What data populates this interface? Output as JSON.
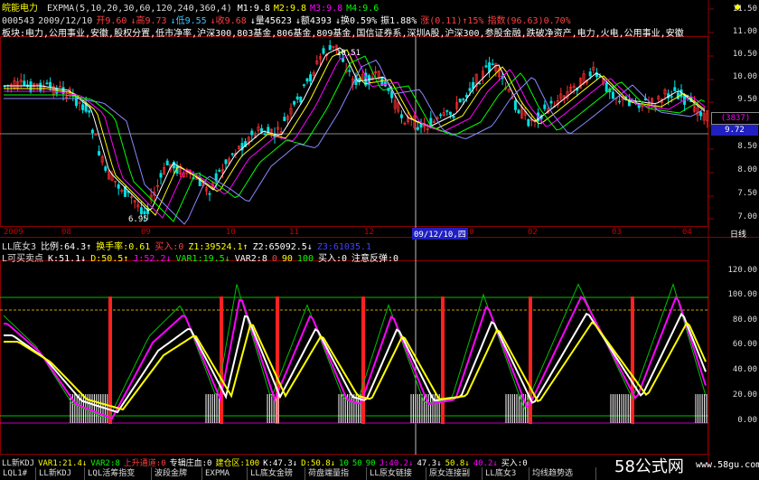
{
  "header": {
    "name": "皖能电力",
    "indicator_line": "EXPMA(5,10,20,30,60,120,240,360,4)",
    "m_values": [
      {
        "label": "M1:9.8",
        "color": "#ffffff"
      },
      {
        "label": "M2:9.8",
        "color": "#ffff00"
      },
      {
        "label": "M3:9.8",
        "color": "#ff00ff"
      },
      {
        "label": "M4:9.6",
        "color": "#00ff00"
      }
    ],
    "quote_line": [
      {
        "text": "000543",
        "color": "#dddddd"
      },
      {
        "text": "2009/12/10",
        "color": "#dddddd"
      },
      {
        "text": "开9.60",
        "color": "#ff4040"
      },
      {
        "text": "↓高9.73",
        "color": "#ff4040"
      },
      {
        "text": "↓低9.55",
        "color": "#40c0ff"
      },
      {
        "text": "↓收9.68",
        "color": "#ff4040"
      },
      {
        "text": "↓量45623",
        "color": "#ffffff"
      },
      {
        "text": "↓额4393",
        "color": "#ffffff"
      },
      {
        "text": "↓换0.59%",
        "color": "#ffffff"
      },
      {
        "text": "振1.88%",
        "color": "#ffffff"
      },
      {
        "text": "涨(0.11)↑15%",
        "color": "#ff4040"
      },
      {
        "text": "指数(96.63)0.70%",
        "color": "#ff4040"
      }
    ],
    "sector_line": "板块:电力,公用事业,安徽,股权分置,低市净率,沪深300,803基金,806基金,809基金,国信证券系,深圳A股,沪深300,参股金融,跌破净资产,电力,火电,公用事业,安徽"
  },
  "price_axis": [
    "11.50",
    "11.00",
    "10.50",
    "10.00",
    "9.50",
    "9.00",
    "8.50",
    "8.00",
    "7.50",
    "7.00"
  ],
  "price_labels": {
    "current_tag": "(3837)",
    "current_price": "9.72",
    "low_mark": "6.95",
    "high_mark": "10.51"
  },
  "time_axis": [
    {
      "label": "2009"
    },
    {
      "label": "08"
    },
    {
      "label": "09"
    },
    {
      "label": "10"
    },
    {
      "label": "11"
    },
    {
      "label": "12"
    },
    {
      "label": "2010"
    },
    {
      "label": "02"
    },
    {
      "label": "03"
    },
    {
      "label": "04"
    }
  ],
  "cursor_date": "09/12/10,四",
  "period_label": "日线",
  "sub1": {
    "line1": [
      {
        "text": "LL底女3",
        "color": "#dddddd"
      },
      {
        "text": "比例:64.3↑",
        "color": "#ffffff"
      },
      {
        "text": "换手率:0.61",
        "color": "#ffff00"
      },
      {
        "text": "买入:0",
        "color": "#ff4040"
      },
      {
        "text": "Z1:39524.1↑",
        "color": "#ffff00"
      },
      {
        "text": "Z2:65092.5↓",
        "color": "#ffffff"
      },
      {
        "text": "Z3:61035.1",
        "color": "#4040ff"
      }
    ],
    "line2": [
      {
        "text": "L可买卖点",
        "color": "#dddddd"
      },
      {
        "text": "K:51.1↓",
        "color": "#ffffff"
      },
      {
        "text": "D:50.5↑",
        "color": "#ffff00"
      },
      {
        "text": "J:52.2↓",
        "color": "#ff00ff"
      },
      {
        "text": "VAR1:19.5↓",
        "color": "#00ff00"
      },
      {
        "text": "VAR2:8",
        "color": "#ffffff"
      },
      {
        "text": "0",
        "color": "#ff4040"
      },
      {
        "text": "90",
        "color": "#ffff00"
      },
      {
        "text": "100",
        "color": "#00ff00"
      },
      {
        "text": "买入:0",
        "color": "#ffffff"
      },
      {
        "text": "注意反弹:0",
        "color": "#ffffff"
      }
    ]
  },
  "sub_axis": [
    "120.00",
    "100.00",
    "80.00",
    "60.00",
    "40.00",
    "20.00",
    "0.00"
  ],
  "sub2_line": [
    {
      "text": "LL新KDJ",
      "color": "#dddddd"
    },
    {
      "text": "VAR1:21.4↓",
      "color": "#ffff00"
    },
    {
      "text": "VAR2:8",
      "color": "#00ff00"
    },
    {
      "text": "上升通道:0",
      "color": "#ff4040"
    },
    {
      "text": "专辑庄血:0",
      "color": "#ffffff"
    },
    {
      "text": "建仓区:100",
      "color": "#ffff00"
    },
    {
      "text": "K:47.3↓",
      "color": "#ffffff"
    },
    {
      "text": "D:50.8↓",
      "color": "#ffff00"
    },
    {
      "text": "10",
      "color": "#00ff00"
    },
    {
      "text": "50",
      "color": "#00ff00"
    },
    {
      "text": "90",
      "color": "#00ff00"
    },
    {
      "text": "J:40.2↓",
      "color": "#ff00ff"
    },
    {
      "text": "47.3↓",
      "color": "#ffffff"
    },
    {
      "text": "50.8↓",
      "color": "#ffff00"
    },
    {
      "text": "40.2↓",
      "color": "#ff00ff"
    },
    {
      "text": "买入:0",
      "color": "#ffffff"
    }
  ],
  "tabs": [
    "LQL1#",
    "LL新KDJ",
    "LQL活筹指变",
    "波段金牌",
    "EXPMA",
    "LL底女金磅",
    "荷盘端量指",
    "LL原女链接",
    "原女连接副",
    "LL底女3",
    "均线趋势选"
  ],
  "watermark": {
    "main": "58公式网",
    "url": "www.58gu.com"
  },
  "scroll_arrow": "◆"
}
